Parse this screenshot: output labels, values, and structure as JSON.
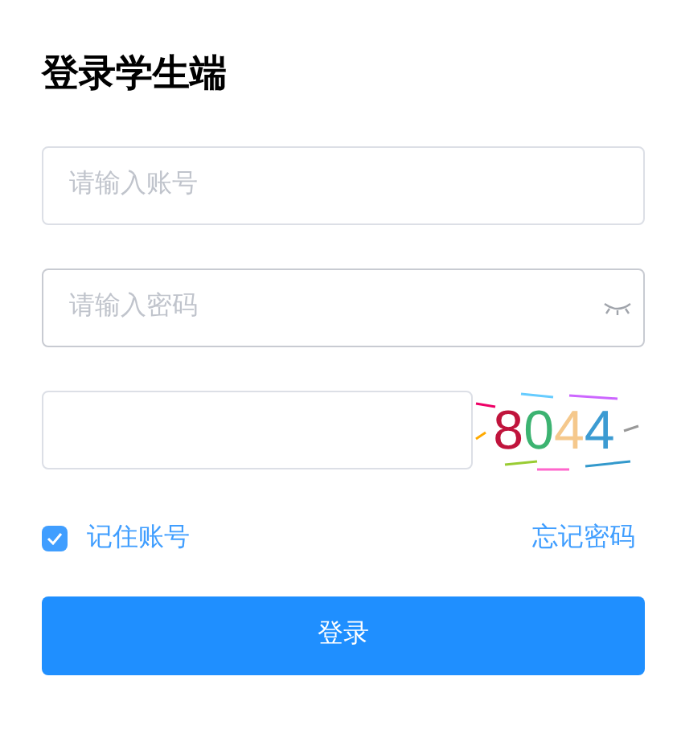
{
  "title": "登录学生端",
  "account": {
    "placeholder": "请输入账号"
  },
  "password": {
    "placeholder": "请输入密码"
  },
  "captcha": {
    "chars": [
      {
        "text": "8",
        "color": "#c0143c"
      },
      {
        "text": "0",
        "color": "#3cb371"
      },
      {
        "text": "4",
        "color": "#f5c88c"
      },
      {
        "text": "4",
        "color": "#3c9bd2"
      }
    ]
  },
  "remember": {
    "label": "记住账号",
    "checked": true
  },
  "forgot": "忘记密码",
  "submit": "登录"
}
